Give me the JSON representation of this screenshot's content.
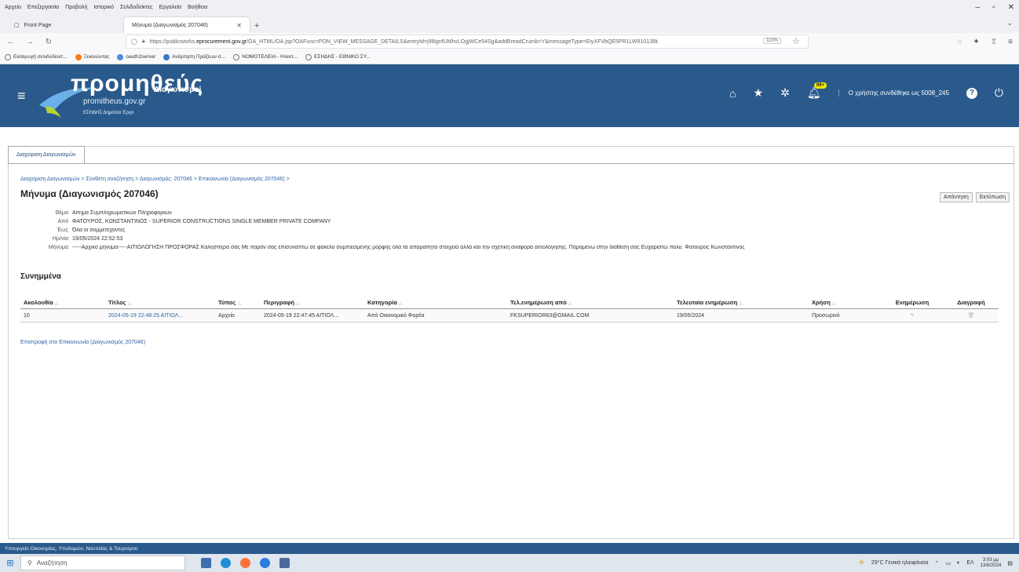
{
  "browser": {
    "menu": [
      "Αρχείο",
      "Επεξεργασία",
      "Προβολή",
      "Ιστορικό",
      "Σελιδοδείκτες",
      "Εργαλεία",
      "Βοήθεια"
    ],
    "tabs": [
      {
        "label": "Front Page"
      },
      {
        "label": "Μήνυμα (Διαγωνισμός 207046)"
      }
    ],
    "url_prefix": "https://publicworks.",
    "url_domain": "eprocurement.gov.gr",
    "url_rest": "/OA_HTML/OA.jsp?OAFunc=PON_VIEW_MESSAGE_DETAILS&entryId=j9l8gnfUMhvLOgjWCe54Sg&addBreadCrumb=Y&messageType=EiyXFVbQE5PR1LW9101J8k",
    "zoom": "110%",
    "bookmarks": [
      "Εισαγωγή σελιδοδεικτ...",
      "Ξεκινώντας",
      "oauth2server",
      "Ανάρτηση Πράξεων σ...",
      "ΝΟΜΟΤΕΛΕΙΑ - Ηλεκτ...",
      "ΕΣΗΔΗΣ - ΕΘΝΙΚΟ ΣΥ..."
    ]
  },
  "header": {
    "logo_title": "προμηθεύς",
    "logo_subtitle": "Διαγωνισμοί",
    "logo_url": "promitheus.gov.gr",
    "logo_esidis": "ΕΣΗΔΗΣ  Δημόσια Έργα",
    "notifications_badge": "99+",
    "user_text": "Ο χρήστης συνδέθηκε ως 5008_245"
  },
  "subtab": "Διαχείριση Διαγωνισμών",
  "breadcrumb": "Διαχείριση Διαγωνισμών  >  Σύνθετη αναζήτηση  >  Διαγωνισμός: 207046  >  Επικοινωνία (Διαγωνισμός 207046)  >",
  "page_title": "Μήνυμα (Διαγωνισμός 207046)",
  "actions": {
    "reply": "Απάντηση",
    "print": "Εκτύπωση"
  },
  "message": {
    "subject_label": "Θέμα",
    "subject": "Αίτημα Συμπληρωματικών Πληροφοριών",
    "from_label": "Από",
    "from": "ΦΑΤΟΥΡΟΣ, ΚΩΝΣΤΑΝΤΙΝΟΣ - SUPERIOR CONSTRUCTIONS SINGLE MEMBER PRIVATE COMPANY",
    "to_label": "Έως",
    "to": "Όλα οι συμμετέχοντες",
    "date_label": "Ημ/νία",
    "date": "19/05/2024 22:52:53",
    "body_label": "Μήνυμα",
    "body": "-----Αρχικό μήνυμα-----ΑΙΤΙΟΛΟΓΗΣΗ ΠΡΟΣΦΟΡΑΣ Καλησπέρα σας Με παρόν σας επισυνάπτω σε φάκελο συμπιεσμένης μορφής όλα τα απαραίτητα στοιχεία αλλά και την σχετική αναφορά αιτιολόγησης. Παραμένω στην διάθεση σας Ευχαριστώ πολύ. Φατούρος Κωνσταντίνος"
  },
  "attachments": {
    "title": "Συνημμένα",
    "columns": [
      "Ακολουθία",
      "Τίτλος",
      "Τύπος",
      "Περιγραφή",
      "Κατηγορία",
      "Τελ.ενημέρωση από",
      "Τελευταία ενημέρωση",
      "Χρήση",
      "Ενημέρωση",
      "Διαγραφή"
    ],
    "rows": [
      {
        "seq": "10",
        "title": "2024-05-19 22:48:25 ΑΙΤΙΟΛ...",
        "type": "Αρχείο",
        "desc": "2024-05-19 22:47:45 ΑΙΤΙΟΛ...",
        "category": "Από Οικονομικό Φορέα",
        "updated_by": "FKSUPERIOR63@GMAIL.COM",
        "updated": "19/05/2024",
        "usage": "Προσωρινό"
      }
    ]
  },
  "return_link": "Επιστροφή στο Επικοινωνία (Διαγωνισμός 207046)",
  "footer": "Υπουργείο Οικονομίας, Υποδομών, Ναυτιλίας & Τουρισμού",
  "taskbar": {
    "search_placeholder": "Αναζήτηση",
    "weather": "29°C  Γενικά ηλιοφάνεια",
    "lang": "ΕΛ",
    "time": "3:03 μμ",
    "date": "13/6/2024"
  }
}
